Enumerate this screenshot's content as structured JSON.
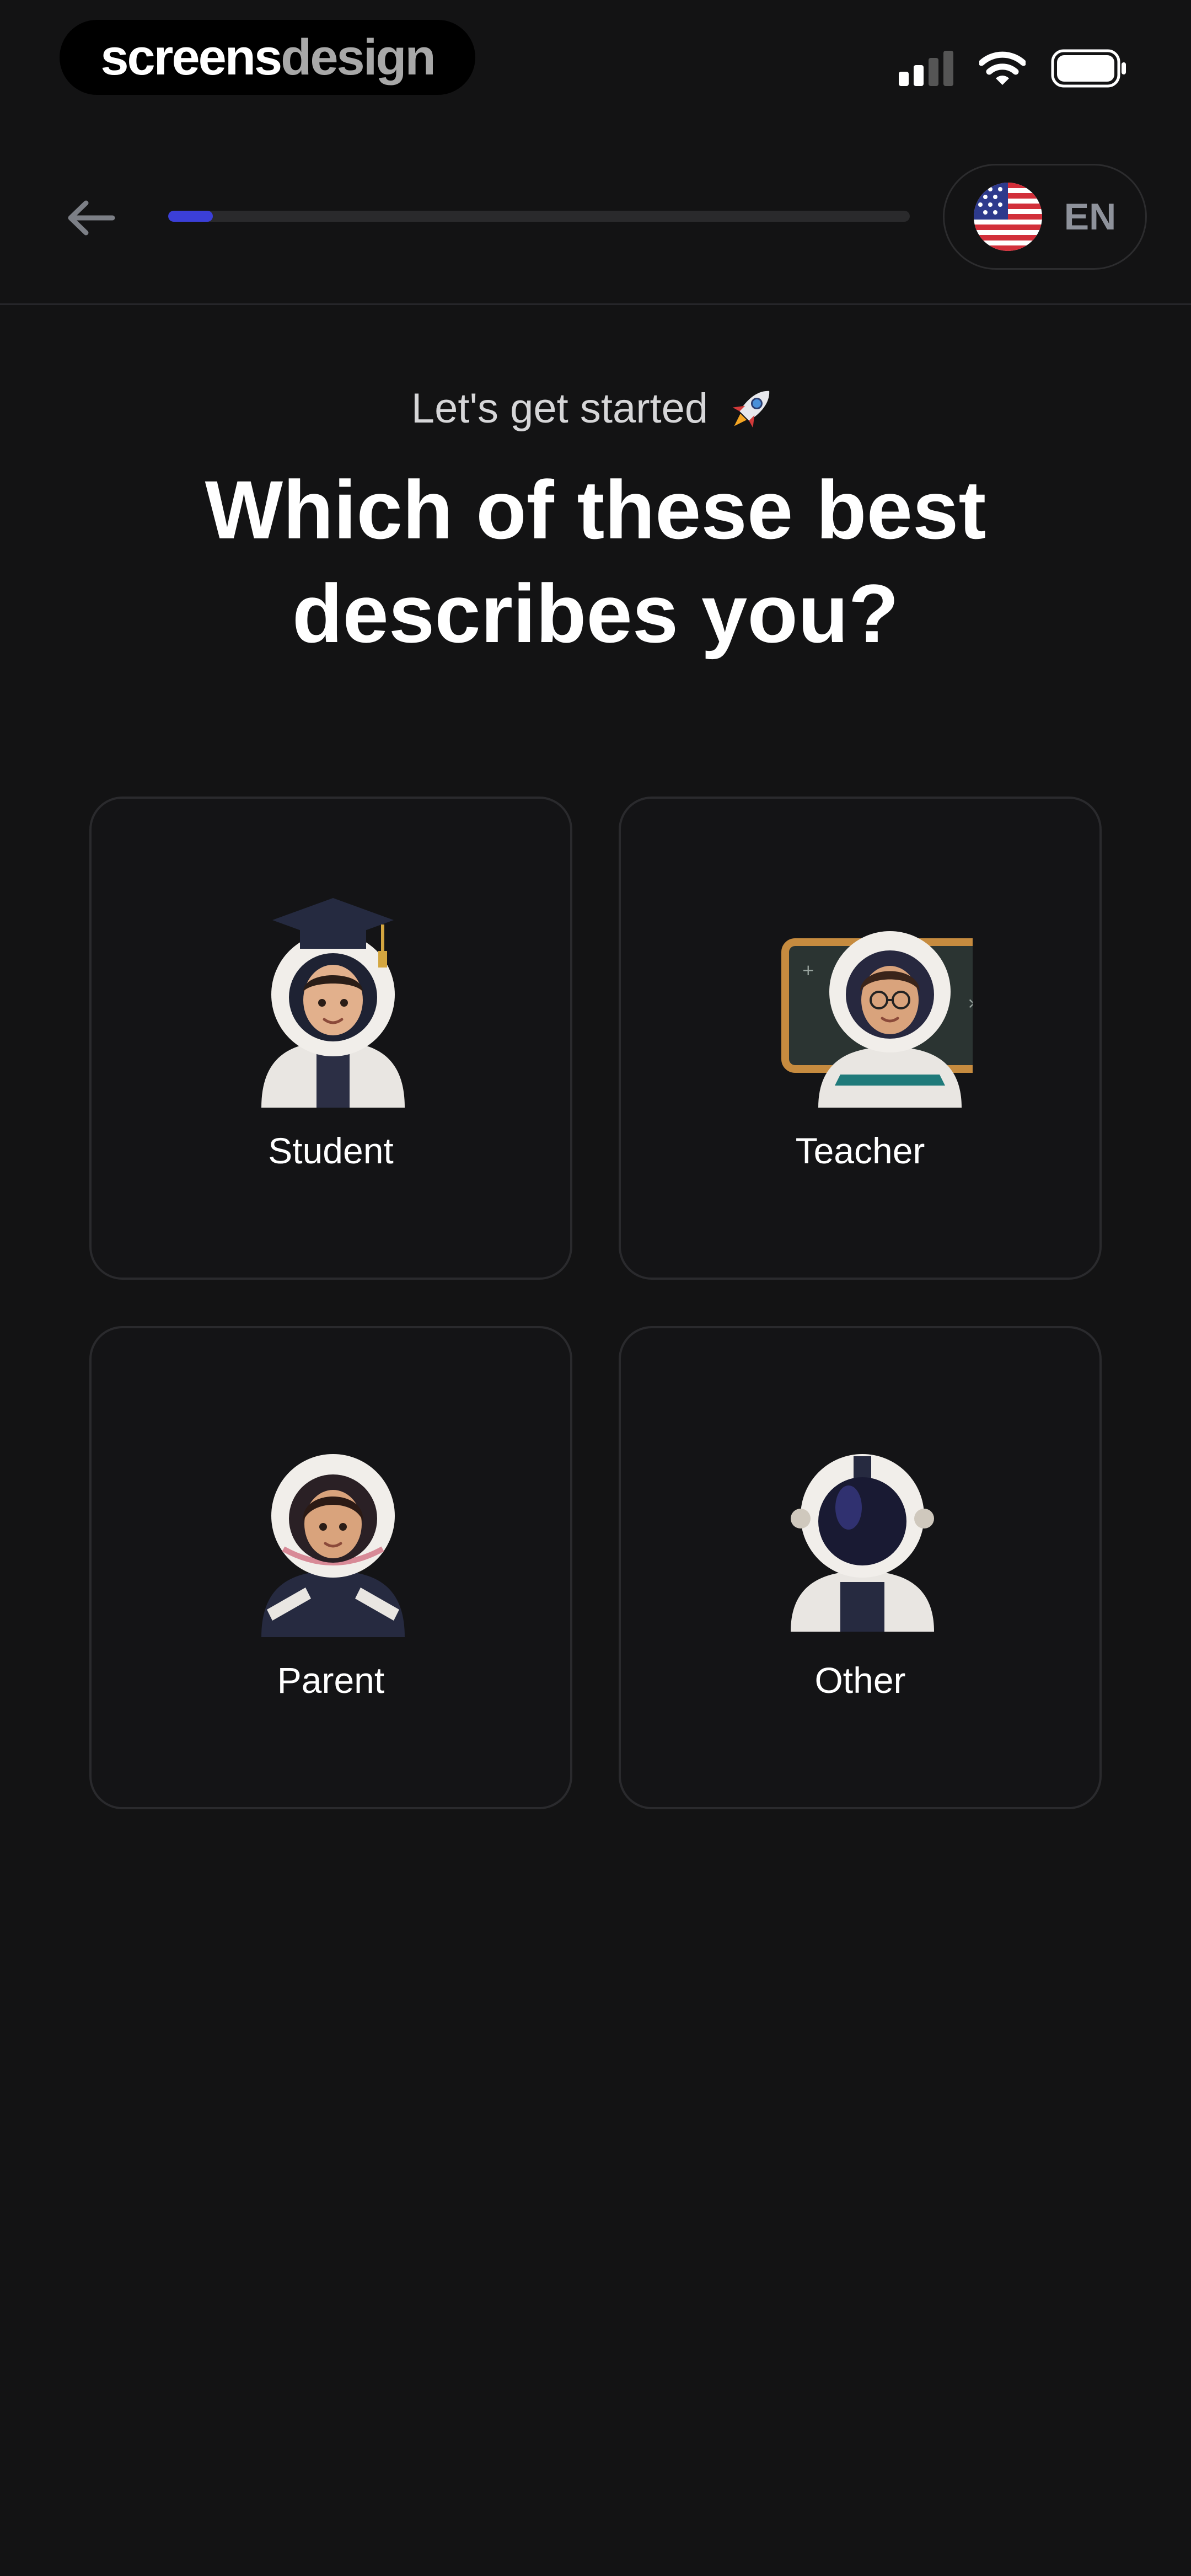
{
  "status_bar": {
    "brand_part1": "screens",
    "brand_part2": "design",
    "signal_icon": "cellular-signal-icon",
    "wifi_icon": "wifi-icon",
    "battery_icon": "battery-icon"
  },
  "nav": {
    "back_icon": "arrow-left-icon",
    "progress": 0.06,
    "progress_color": "#3b3fd8",
    "language_flag": "us-flag-icon",
    "language_code": "EN"
  },
  "header": {
    "subtitle": "Let's get started",
    "subtitle_emoji": "rocket-icon",
    "title_line1": "Which of these best",
    "title_line2": "describes you?"
  },
  "options": [
    {
      "label": "Student",
      "avatar": "astronaut-student-avatar"
    },
    {
      "label": "Teacher",
      "avatar": "astronaut-teacher-avatar"
    },
    {
      "label": "Parent",
      "avatar": "astronaut-parent-avatar"
    },
    {
      "label": "Other",
      "avatar": "astronaut-other-avatar"
    }
  ],
  "colors": {
    "background": "#131314",
    "card_border": "#2a2a2d",
    "accent": "#3b3fd8"
  }
}
